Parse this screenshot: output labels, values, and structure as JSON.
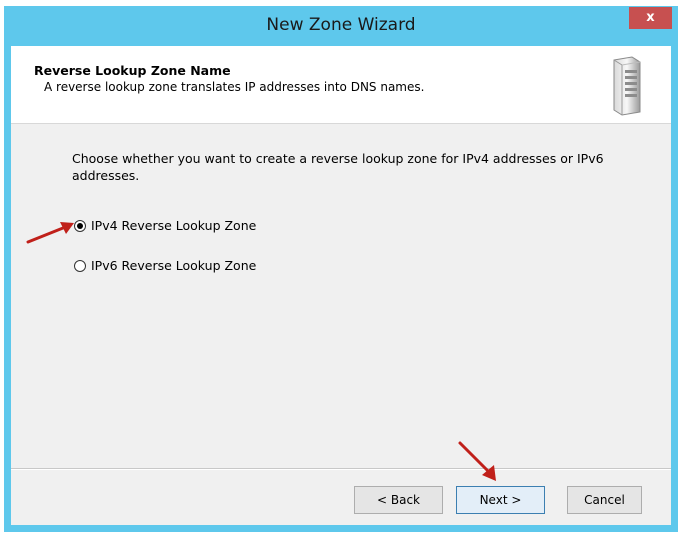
{
  "window": {
    "title": "New Zone Wizard",
    "close_label": "x"
  },
  "header": {
    "title": "Reverse Lookup Zone Name",
    "subtitle": "A reverse lookup zone translates IP addresses into DNS names.",
    "icon": "server-icon"
  },
  "body": {
    "prompt": "Choose whether you want to create a reverse lookup zone for IPv4 addresses or IPv6 addresses.",
    "options": [
      {
        "label": "IPv4 Reverse Lookup Zone",
        "selected": true
      },
      {
        "label": "IPv6 Reverse Lookup Zone",
        "selected": false
      }
    ]
  },
  "buttons": {
    "back": "< Back",
    "next": "Next >",
    "cancel": "Cancel"
  },
  "colors": {
    "title_bar": "#5ec8ec",
    "close_button": "#c75050",
    "annotation_arrow": "#c0201a"
  }
}
